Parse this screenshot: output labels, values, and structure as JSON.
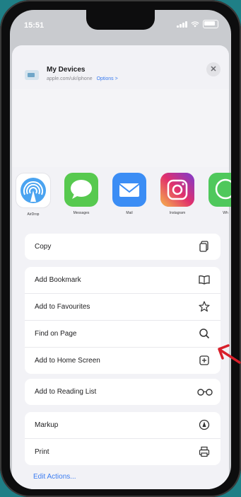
{
  "status_bar": {
    "time": "15:51"
  },
  "share_header": {
    "title": "My Devices",
    "subtitle": "apple.com/uk/iphone",
    "options_label": "Options >",
    "close_symbol": "✕"
  },
  "apps": [
    {
      "label": "AirDrop",
      "icon": "airdrop-icon"
    },
    {
      "label": "Messages",
      "icon": "messages-icon"
    },
    {
      "label": "Mail",
      "icon": "mail-icon"
    },
    {
      "label": "Instagram",
      "icon": "instagram-icon"
    },
    {
      "label": "Wh",
      "icon": "whatsapp-icon"
    }
  ],
  "groups": [
    {
      "items": [
        {
          "label": "Copy",
          "icon": "copy-icon"
        }
      ]
    },
    {
      "items": [
        {
          "label": "Add Bookmark",
          "icon": "book-icon"
        },
        {
          "label": "Add to Favourites",
          "icon": "star-icon"
        },
        {
          "label": "Find on Page",
          "icon": "search-icon"
        },
        {
          "label": "Add to Home Screen",
          "icon": "add-square-icon"
        }
      ]
    },
    {
      "items": [
        {
          "label": "Add to Reading List",
          "icon": "glasses-icon"
        }
      ]
    },
    {
      "items": [
        {
          "label": "Markup",
          "icon": "markup-icon"
        },
        {
          "label": "Print",
          "icon": "print-icon"
        }
      ]
    }
  ],
  "edit_actions": "Edit Actions...",
  "colors": {
    "accent": "#3b7cf0",
    "annotation_arrow": "#d81f2a",
    "background": "#1f7f86"
  }
}
